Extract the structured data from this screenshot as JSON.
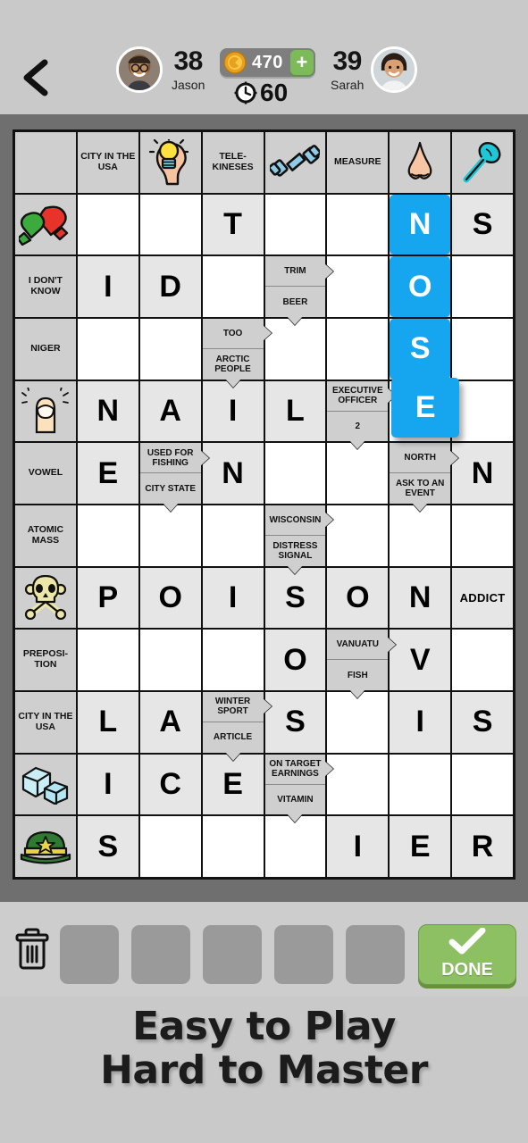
{
  "header": {
    "back_icon": "chevron-left-icon",
    "left_player": {
      "name": "Jason",
      "score": "38",
      "avatar": "male-avatar"
    },
    "right_player": {
      "name": "Sarah",
      "score": "39",
      "avatar": "female-avatar"
    },
    "coins": {
      "icon": "coin-icon",
      "amount": "470",
      "plus_label": "+"
    },
    "timer": {
      "icon": "clock-icon",
      "value": "60"
    }
  },
  "grid": {
    "columns": 8,
    "rows": 12,
    "cells": [
      {
        "r": 0,
        "c": 0,
        "type": "clue"
      },
      {
        "r": 0,
        "c": 1,
        "type": "clue",
        "text": "CITY IN THE USA"
      },
      {
        "r": 0,
        "c": 2,
        "type": "clue",
        "icon": "lightbulb-head-icon"
      },
      {
        "r": 0,
        "c": 3,
        "type": "clue",
        "text": "TELE-KINESES"
      },
      {
        "r": 0,
        "c": 4,
        "type": "clue",
        "icon": "dumbbell-icon"
      },
      {
        "r": 0,
        "c": 5,
        "type": "clue",
        "text": "MEASURE"
      },
      {
        "r": 0,
        "c": 6,
        "type": "clue",
        "icon": "nose-icon"
      },
      {
        "r": 0,
        "c": 7,
        "type": "clue",
        "icon": "spoon-icon"
      },
      {
        "r": 1,
        "c": 0,
        "type": "clue",
        "icon": "mittens-icon"
      },
      {
        "r": 1,
        "c": 1,
        "type": "empty"
      },
      {
        "r": 1,
        "c": 2,
        "type": "empty"
      },
      {
        "r": 1,
        "c": 3,
        "type": "filled",
        "letter": "T"
      },
      {
        "r": 1,
        "c": 4,
        "type": "empty"
      },
      {
        "r": 1,
        "c": 5,
        "type": "empty"
      },
      {
        "r": 1,
        "c": 6,
        "type": "blue",
        "letter": "N"
      },
      {
        "r": 1,
        "c": 7,
        "type": "filled",
        "letter": "S"
      },
      {
        "r": 2,
        "c": 0,
        "type": "clue",
        "text": "I DON'T KNOW"
      },
      {
        "r": 2,
        "c": 1,
        "type": "filled",
        "letter": "I"
      },
      {
        "r": 2,
        "c": 2,
        "type": "filled",
        "letter": "D"
      },
      {
        "r": 2,
        "c": 3,
        "type": "empty"
      },
      {
        "r": 2,
        "c": 4,
        "type": "split",
        "top": "TRIM",
        "bottom": "BEER",
        "arrow_top": "right",
        "arrow_bottom": "down"
      },
      {
        "r": 2,
        "c": 5,
        "type": "empty"
      },
      {
        "r": 2,
        "c": 6,
        "type": "blue",
        "letter": "O"
      },
      {
        "r": 2,
        "c": 7,
        "type": "empty"
      },
      {
        "r": 3,
        "c": 0,
        "type": "clue",
        "text": "NIGER"
      },
      {
        "r": 3,
        "c": 1,
        "type": "empty"
      },
      {
        "r": 3,
        "c": 2,
        "type": "empty"
      },
      {
        "r": 3,
        "c": 3,
        "type": "split",
        "top": "TOO",
        "bottom": "ARCTIC PEOPLE",
        "arrow_top": "right",
        "arrow_bottom": "down"
      },
      {
        "r": 3,
        "c": 4,
        "type": "empty"
      },
      {
        "r": 3,
        "c": 5,
        "type": "empty"
      },
      {
        "r": 3,
        "c": 6,
        "type": "blue",
        "letter": "S"
      },
      {
        "r": 3,
        "c": 7,
        "type": "empty"
      },
      {
        "r": 4,
        "c": 0,
        "type": "clue",
        "icon": "fingernail-icon"
      },
      {
        "r": 4,
        "c": 1,
        "type": "filled",
        "letter": "N"
      },
      {
        "r": 4,
        "c": 2,
        "type": "filled",
        "letter": "A"
      },
      {
        "r": 4,
        "c": 3,
        "type": "filled",
        "letter": "I"
      },
      {
        "r": 4,
        "c": 4,
        "type": "filled",
        "letter": "L"
      },
      {
        "r": 4,
        "c": 5,
        "type": "split",
        "top": "EXECUTIVE OFFICER",
        "bottom": "2",
        "arrow_top": "right",
        "arrow_bottom": "down"
      },
      {
        "r": 4,
        "c": 6,
        "type": "blue-lifted",
        "letter": "E"
      },
      {
        "r": 4,
        "c": 7,
        "type": "empty"
      },
      {
        "r": 5,
        "c": 0,
        "type": "clue",
        "text": "VOWEL"
      },
      {
        "r": 5,
        "c": 1,
        "type": "filled",
        "letter": "E"
      },
      {
        "r": 5,
        "c": 2,
        "type": "split",
        "top": "USED FOR FISHING",
        "bottom": "CITY STATE",
        "arrow_top": "right",
        "arrow_bottom": "down"
      },
      {
        "r": 5,
        "c": 3,
        "type": "filled",
        "letter": "N"
      },
      {
        "r": 5,
        "c": 4,
        "type": "empty"
      },
      {
        "r": 5,
        "c": 5,
        "type": "empty"
      },
      {
        "r": 5,
        "c": 6,
        "type": "split",
        "top": "NORTH",
        "bottom": "ASK TO AN EVENT",
        "arrow_top": "right",
        "arrow_bottom": "down"
      },
      {
        "r": 5,
        "c": 7,
        "type": "filled",
        "letter": "N"
      },
      {
        "r": 6,
        "c": 0,
        "type": "clue",
        "text": "ATOMIC MASS"
      },
      {
        "r": 6,
        "c": 1,
        "type": "empty"
      },
      {
        "r": 6,
        "c": 2,
        "type": "empty"
      },
      {
        "r": 6,
        "c": 3,
        "type": "empty"
      },
      {
        "r": 6,
        "c": 4,
        "type": "split",
        "top": "WISCONSIN",
        "bottom": "DISTRESS SIGNAL",
        "arrow_top": "right",
        "arrow_bottom": "down"
      },
      {
        "r": 6,
        "c": 5,
        "type": "empty"
      },
      {
        "r": 6,
        "c": 6,
        "type": "empty"
      },
      {
        "r": 6,
        "c": 7,
        "type": "empty"
      },
      {
        "r": 7,
        "c": 0,
        "type": "clue",
        "icon": "skull-icon"
      },
      {
        "r": 7,
        "c": 1,
        "type": "filled",
        "letter": "P"
      },
      {
        "r": 7,
        "c": 2,
        "type": "filled",
        "letter": "O"
      },
      {
        "r": 7,
        "c": 3,
        "type": "filled",
        "letter": "I"
      },
      {
        "r": 7,
        "c": 4,
        "type": "filled",
        "letter": "S"
      },
      {
        "r": 7,
        "c": 5,
        "type": "filled",
        "letter": "O"
      },
      {
        "r": 7,
        "c": 6,
        "type": "filled",
        "letter": "N"
      },
      {
        "r": 7,
        "c": 7,
        "type": "filled",
        "letter": "ADDICT",
        "small": true
      },
      {
        "r": 8,
        "c": 0,
        "type": "clue",
        "text": "PREPOSI-TION"
      },
      {
        "r": 8,
        "c": 1,
        "type": "empty"
      },
      {
        "r": 8,
        "c": 2,
        "type": "empty"
      },
      {
        "r": 8,
        "c": 3,
        "type": "empty"
      },
      {
        "r": 8,
        "c": 4,
        "type": "filled",
        "letter": "O"
      },
      {
        "r": 8,
        "c": 5,
        "type": "split",
        "top": "VANUATU",
        "bottom": "FISH",
        "arrow_top": "right",
        "arrow_bottom": "down"
      },
      {
        "r": 8,
        "c": 6,
        "type": "filled",
        "letter": "V"
      },
      {
        "r": 8,
        "c": 7,
        "type": "empty"
      },
      {
        "r": 9,
        "c": 0,
        "type": "clue",
        "text": "CITY IN THE USA"
      },
      {
        "r": 9,
        "c": 1,
        "type": "filled",
        "letter": "L"
      },
      {
        "r": 9,
        "c": 2,
        "type": "filled",
        "letter": "A"
      },
      {
        "r": 9,
        "c": 3,
        "type": "split",
        "top": "WINTER SPORT",
        "bottom": "ARTICLE",
        "arrow_top": "right",
        "arrow_bottom": "down"
      },
      {
        "r": 9,
        "c": 4,
        "type": "filled",
        "letter": "S"
      },
      {
        "r": 9,
        "c": 5,
        "type": "empty"
      },
      {
        "r": 9,
        "c": 6,
        "type": "filled",
        "letter": "I"
      },
      {
        "r": 9,
        "c": 7,
        "type": "filled",
        "letter": "S"
      },
      {
        "r": 10,
        "c": 0,
        "type": "clue",
        "icon": "ice-cubes-icon"
      },
      {
        "r": 10,
        "c": 1,
        "type": "filled",
        "letter": "I"
      },
      {
        "r": 10,
        "c": 2,
        "type": "filled",
        "letter": "C"
      },
      {
        "r": 10,
        "c": 3,
        "type": "filled",
        "letter": "E"
      },
      {
        "r": 10,
        "c": 4,
        "type": "split",
        "top": "ON TARGET EARNINGS",
        "bottom": "VITAMIN",
        "arrow_top": "right",
        "arrow_bottom": "down"
      },
      {
        "r": 10,
        "c": 5,
        "type": "empty"
      },
      {
        "r": 10,
        "c": 6,
        "type": "empty"
      },
      {
        "r": 10,
        "c": 7,
        "type": "empty"
      },
      {
        "r": 11,
        "c": 0,
        "type": "clue",
        "icon": "military-cap-icon"
      },
      {
        "r": 11,
        "c": 1,
        "type": "filled",
        "letter": "S"
      },
      {
        "r": 11,
        "c": 2,
        "type": "empty"
      },
      {
        "r": 11,
        "c": 3,
        "type": "empty"
      },
      {
        "r": 11,
        "c": 4,
        "type": "empty"
      },
      {
        "r": 11,
        "c": 5,
        "type": "filled",
        "letter": "I"
      },
      {
        "r": 11,
        "c": 6,
        "type": "filled",
        "letter": "E"
      },
      {
        "r": 11,
        "c": 7,
        "type": "filled",
        "letter": "R"
      }
    ]
  },
  "toolbar": {
    "trash_icon": "trash-icon",
    "rack_slots": [
      "",
      "",
      "",
      "",
      ""
    ],
    "done_label": "DONE",
    "done_icon": "check-icon"
  },
  "tagline": {
    "line1": "Easy to Play",
    "line2": "Hard to Master"
  },
  "colors": {
    "accent_blue": "#16a6ef",
    "done_green": "#8cc063",
    "clue_gray": "#cfcfcf",
    "filled_gray": "#e6e6e6",
    "band_gray": "#6f6f6f",
    "page_gray": "#c9c9c9"
  }
}
